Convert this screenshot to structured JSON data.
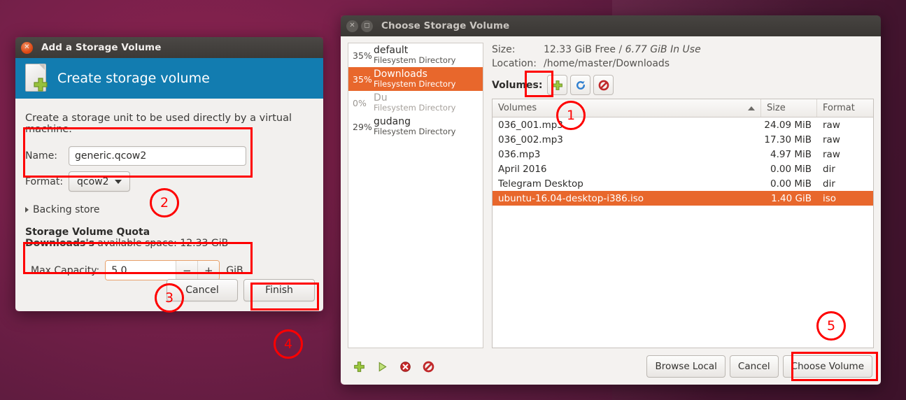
{
  "add_dialog": {
    "title": "Add a Storage Volume",
    "close_icon": "close-icon",
    "banner_title": "Create storage volume",
    "intro": "Create a storage unit to be used directly by a virtual machine.",
    "name_label": "Name:",
    "name_value": "generic.qcow2",
    "format_label": "Format:",
    "format_value": "qcow2",
    "backing_store_label": "Backing store",
    "quota_heading": "Storage Volume Quota",
    "quota_pool": "Downloads's",
    "quota_rest": " available space: 12.33 GiB",
    "capacity_label": "Max Capacity:",
    "capacity_value": "5.0",
    "capacity_unit": "GiB",
    "minus_label": "−",
    "plus_label": "+",
    "cancel_label": "Cancel",
    "finish_label": "Finish"
  },
  "choose_dialog": {
    "title": "Choose Storage Volume",
    "close_icon": "close-icon",
    "maximize_icon": "maximize-icon",
    "size_label": "Size:",
    "size_free": "12.33 GiB Free / ",
    "size_inuse": "6.77 GiB In Use",
    "location_label": "Location:",
    "location_value": "/home/master/Downloads",
    "volumes_label": "Volumes:",
    "toolbar_icons": [
      "add-volume-icon",
      "refresh-volumes-icon",
      "delete-volume-icon"
    ],
    "pools": [
      {
        "pct": "35%",
        "name": "default",
        "type": "Filesystem Directory",
        "state": "normal"
      },
      {
        "pct": "35%",
        "name": "Downloads",
        "type": "Filesystem Directory",
        "state": "selected"
      },
      {
        "pct": "0%",
        "name": "Du",
        "type": "Filesystem Directory",
        "state": "inactive"
      },
      {
        "pct": "29%",
        "name": "gudang",
        "type": "Filesystem Directory",
        "state": "normal"
      }
    ],
    "columns": [
      "Volumes",
      "Size",
      "Format"
    ],
    "rows": [
      {
        "name": "036_001.mp3",
        "size": "24.09 MiB",
        "format": "raw",
        "selected": false
      },
      {
        "name": "036_002.mp3",
        "size": "17.30 MiB",
        "format": "raw",
        "selected": false
      },
      {
        "name": "036.mp3",
        "size": "4.97 MiB",
        "format": "raw",
        "selected": false
      },
      {
        "name": "April 2016",
        "size": "0.00 MiB",
        "format": "dir",
        "selected": false
      },
      {
        "name": "Telegram Desktop",
        "size": "0.00 MiB",
        "format": "dir",
        "selected": false
      },
      {
        "name": "ubuntu-16.04-desktop-i386.iso",
        "size": "1.40 GiB",
        "format": "iso",
        "selected": true
      }
    ],
    "footer_icons": [
      "new-volume-icon",
      "start-volume-icon",
      "stop-volume-icon",
      "delete-pool-icon"
    ],
    "browse_local_label": "Browse Local",
    "cancel_label": "Cancel",
    "choose_volume_label": "Choose Volume"
  },
  "annotations": {
    "markers": [
      "1",
      "2",
      "3",
      "4",
      "5"
    ],
    "color": "#fe0000"
  }
}
